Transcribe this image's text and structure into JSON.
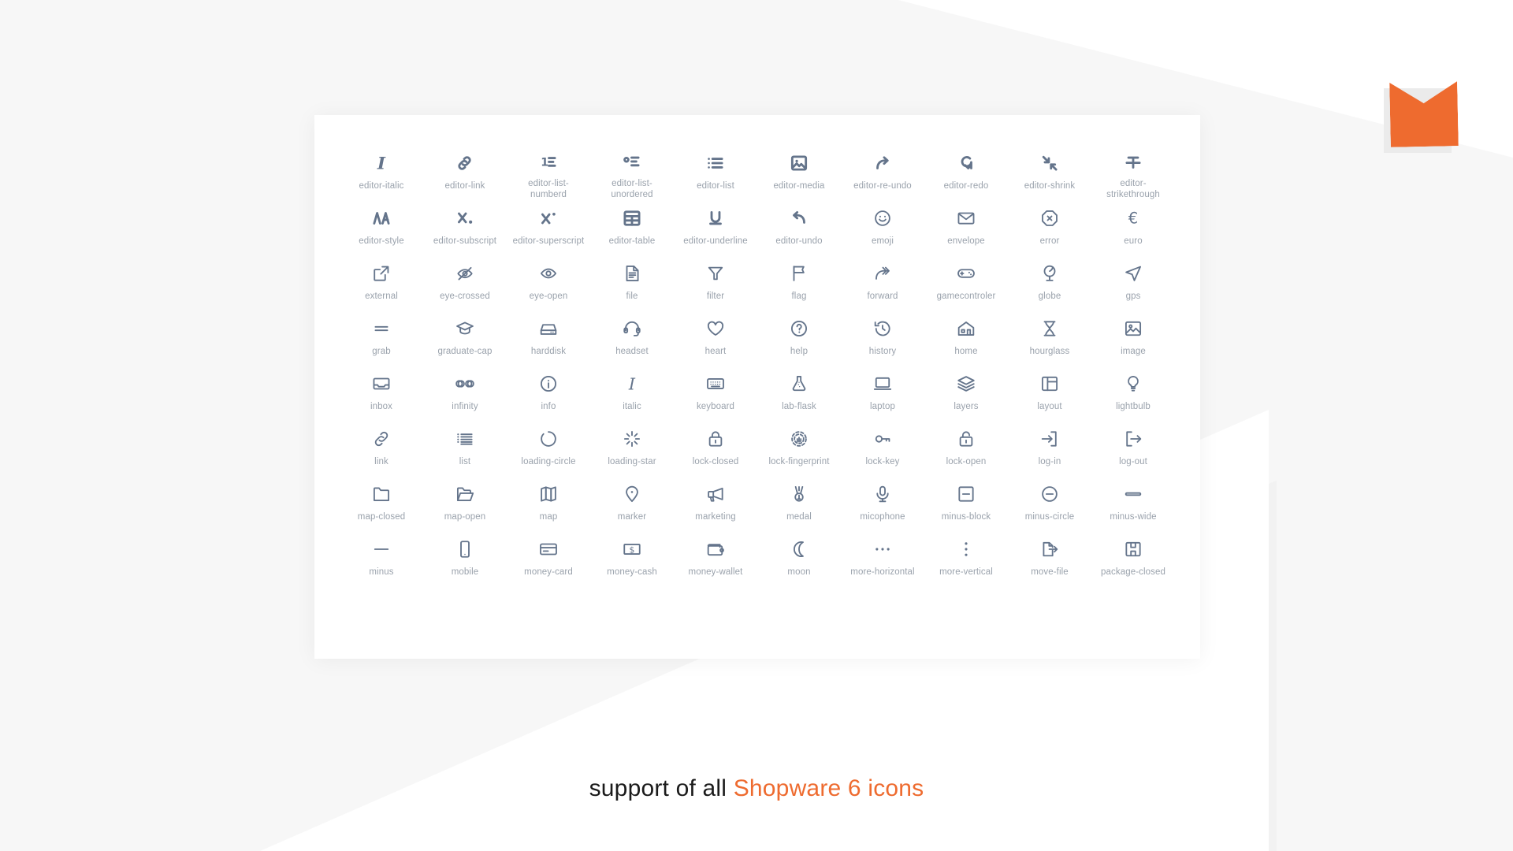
{
  "page": {
    "background_color": "#f7f7f7",
    "card_color": "#ffffff",
    "accent_color": "#ee6b2f",
    "icon_color": "#64748b",
    "label_color": "#9aa2ac"
  },
  "logo": {
    "name": "shopware-logo",
    "color": "#ee6b2f"
  },
  "caption": {
    "prefix": "support of all ",
    "accent": "Shopware 6 icons",
    "full_text": "support of all Shopware 6 icons"
  },
  "icon_grid": {
    "columns": 10,
    "rows": 8,
    "total": 80,
    "icons": [
      {
        "label": "editor-italic",
        "icon": "editor-italic-icon"
      },
      {
        "label": "editor-link",
        "icon": "editor-link-icon"
      },
      {
        "label": "editor-list-numberd",
        "icon": "editor-list-numbered-icon"
      },
      {
        "label": "editor-list-unordered",
        "icon": "editor-list-unordered-icon"
      },
      {
        "label": "editor-list",
        "icon": "editor-list-icon"
      },
      {
        "label": "editor-media",
        "icon": "editor-media-icon"
      },
      {
        "label": "editor-re-undo",
        "icon": "editor-re-undo-icon"
      },
      {
        "label": "editor-redo",
        "icon": "editor-redo-icon"
      },
      {
        "label": "editor-shrink",
        "icon": "editor-shrink-icon"
      },
      {
        "label": "editor-strikethrough",
        "icon": "editor-strikethrough-icon"
      },
      {
        "label": "editor-style",
        "icon": "editor-style-icon"
      },
      {
        "label": "editor-subscript",
        "icon": "editor-subscript-icon"
      },
      {
        "label": "editor-superscript",
        "icon": "editor-superscript-icon"
      },
      {
        "label": "editor-table",
        "icon": "editor-table-icon"
      },
      {
        "label": "editor-underline",
        "icon": "editor-underline-icon"
      },
      {
        "label": "editor-undo",
        "icon": "editor-undo-icon"
      },
      {
        "label": "emoji",
        "icon": "emoji-icon"
      },
      {
        "label": "envelope",
        "icon": "envelope-icon"
      },
      {
        "label": "error",
        "icon": "error-icon"
      },
      {
        "label": "euro",
        "icon": "euro-icon"
      },
      {
        "label": "external",
        "icon": "external-icon"
      },
      {
        "label": "eye-crossed",
        "icon": "eye-crossed-icon"
      },
      {
        "label": "eye-open",
        "icon": "eye-open-icon"
      },
      {
        "label": "file",
        "icon": "file-icon"
      },
      {
        "label": "filter",
        "icon": "filter-icon"
      },
      {
        "label": "flag",
        "icon": "flag-icon"
      },
      {
        "label": "forward",
        "icon": "forward-icon"
      },
      {
        "label": "gamecontroler",
        "icon": "gamecontroller-icon"
      },
      {
        "label": "globe",
        "icon": "globe-icon"
      },
      {
        "label": "gps",
        "icon": "gps-icon"
      },
      {
        "label": "grab",
        "icon": "grab-icon"
      },
      {
        "label": "graduate-cap",
        "icon": "graduate-cap-icon"
      },
      {
        "label": "harddisk",
        "icon": "harddisk-icon"
      },
      {
        "label": "headset",
        "icon": "headset-icon"
      },
      {
        "label": "heart",
        "icon": "heart-icon"
      },
      {
        "label": "help",
        "icon": "help-icon"
      },
      {
        "label": "history",
        "icon": "history-icon"
      },
      {
        "label": "home",
        "icon": "home-icon"
      },
      {
        "label": "hourglass",
        "icon": "hourglass-icon"
      },
      {
        "label": "image",
        "icon": "image-icon"
      },
      {
        "label": "inbox",
        "icon": "inbox-icon"
      },
      {
        "label": "infinity",
        "icon": "infinity-icon"
      },
      {
        "label": "info",
        "icon": "info-icon"
      },
      {
        "label": "italic",
        "icon": "italic-icon"
      },
      {
        "label": "keyboard",
        "icon": "keyboard-icon"
      },
      {
        "label": "lab-flask",
        "icon": "lab-flask-icon"
      },
      {
        "label": "laptop",
        "icon": "laptop-icon"
      },
      {
        "label": "layers",
        "icon": "layers-icon"
      },
      {
        "label": "layout",
        "icon": "layout-icon"
      },
      {
        "label": "lightbulb",
        "icon": "lightbulb-icon"
      },
      {
        "label": "link",
        "icon": "link-icon"
      },
      {
        "label": "list",
        "icon": "list-icon"
      },
      {
        "label": "loading-circle",
        "icon": "loading-circle-icon"
      },
      {
        "label": "loading-star",
        "icon": "loading-star-icon"
      },
      {
        "label": "lock-closed",
        "icon": "lock-closed-icon"
      },
      {
        "label": "lock-fingerprint",
        "icon": "lock-fingerprint-icon"
      },
      {
        "label": "lock-key",
        "icon": "lock-key-icon"
      },
      {
        "label": "lock-open",
        "icon": "lock-open-icon"
      },
      {
        "label": "log-in",
        "icon": "log-in-icon"
      },
      {
        "label": "log-out",
        "icon": "log-out-icon"
      },
      {
        "label": "map-closed",
        "icon": "map-closed-icon"
      },
      {
        "label": "map-open",
        "icon": "map-open-icon"
      },
      {
        "label": "map",
        "icon": "map-icon"
      },
      {
        "label": "marker",
        "icon": "marker-icon"
      },
      {
        "label": "marketing",
        "icon": "marketing-icon"
      },
      {
        "label": "medal",
        "icon": "medal-icon"
      },
      {
        "label": "micophone",
        "icon": "microphone-icon"
      },
      {
        "label": "minus-block",
        "icon": "minus-block-icon"
      },
      {
        "label": "minus-circle",
        "icon": "minus-circle-icon"
      },
      {
        "label": "minus-wide",
        "icon": "minus-wide-icon"
      },
      {
        "label": "minus",
        "icon": "minus-icon"
      },
      {
        "label": "mobile",
        "icon": "mobile-icon"
      },
      {
        "label": "money-card",
        "icon": "money-card-icon"
      },
      {
        "label": "money-cash",
        "icon": "money-cash-icon"
      },
      {
        "label": "money-wallet",
        "icon": "money-wallet-icon"
      },
      {
        "label": "moon",
        "icon": "moon-icon"
      },
      {
        "label": "more-horizontal",
        "icon": "more-horizontal-icon"
      },
      {
        "label": "more-vertical",
        "icon": "more-vertical-icon"
      },
      {
        "label": "move-file",
        "icon": "move-file-icon"
      },
      {
        "label": "package-closed",
        "icon": "package-closed-icon"
      }
    ]
  }
}
